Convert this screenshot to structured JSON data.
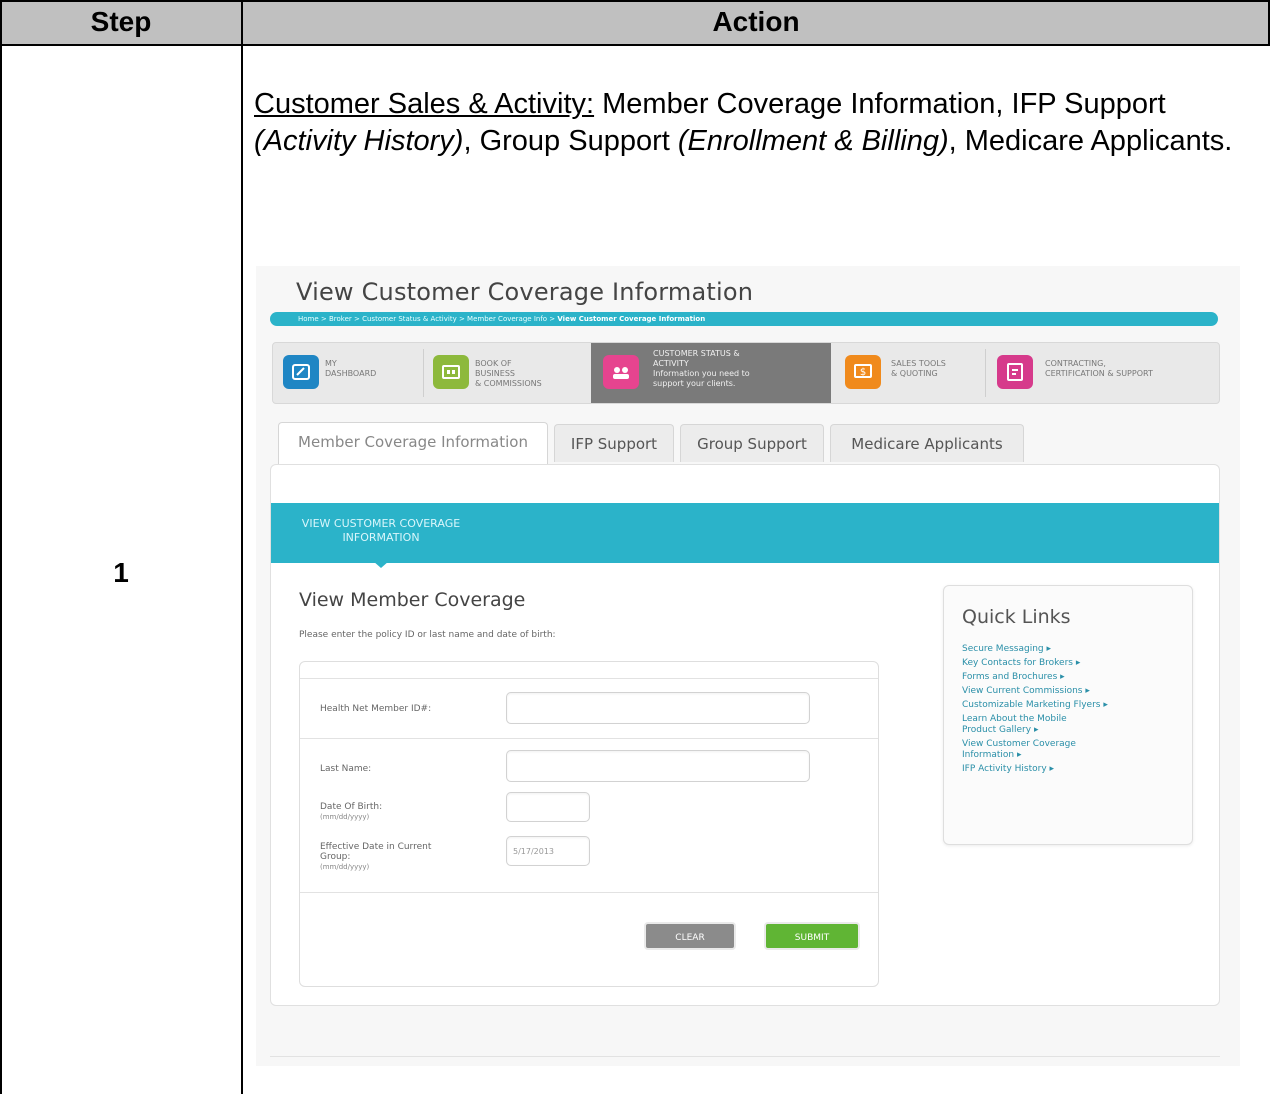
{
  "table": {
    "header_step": "Step",
    "header_action": "Action",
    "step_number": "1"
  },
  "instruction": {
    "lead": "Customer Sales & Activity:",
    "t1": " Member Coverage Information, IFP Support ",
    "i1": "(Activity History)",
    "t2": ", Group Support ",
    "i2": "(Enrollment & Billing)",
    "t3": ", Medicare Applicants."
  },
  "screenshot": {
    "page_title": "View Customer Coverage Information",
    "breadcrumb": {
      "path": "Home > Broker > Customer Status & Activity > Member Coverage Info > ",
      "current": "View Customer Coverage Information"
    },
    "nav": [
      {
        "l1": "MY",
        "l2": "DASHBOARD",
        "l3": "",
        "l4": "",
        "color": "#1f86c4"
      },
      {
        "l1": "BOOK OF",
        "l2": "BUSINESS",
        "l3": "& COMMISSIONS",
        "l4": "",
        "color": "#8db93c"
      },
      {
        "l1": "CUSTOMER STATUS &",
        "l2": "ACTIVITY",
        "l3": "Information you need to",
        "l4": "support your clients.",
        "color": "#e6448f"
      },
      {
        "l1": "SALES TOOLS",
        "l2": "& QUOTING",
        "l3": "",
        "l4": "",
        "color": "#f08a1c"
      },
      {
        "l1": "CONTRACTING,",
        "l2": "CERTIFICATION & SUPPORT",
        "l3": "",
        "l4": "",
        "color": "#d63a8b"
      }
    ],
    "tabs": [
      "Member Coverage Information",
      "IFP Support",
      "Group Support",
      "Medicare Applicants"
    ],
    "banner_label": "VIEW CUSTOMER COVERAGE INFORMATION",
    "section_title": "View Member Coverage",
    "section_instruction": "Please enter the policy ID or last name and date of birth:",
    "form": {
      "member_id_label": "Health Net Member ID#:",
      "last_name_label": "Last Name:",
      "dob_label": "Date Of Birth:",
      "dob_hint": "(mm/dd/yyyy)",
      "eff_label_1": "Effective Date in Current",
      "eff_label_2": "Group:",
      "eff_hint": "(mm/dd/yyyy)",
      "eff_value": "5/17/2013",
      "clear_label": "CLEAR",
      "submit_label": "SUBMIT"
    },
    "quick_links": {
      "title": "Quick Links",
      "items": [
        "Secure Messaging",
        "Key Contacts for Brokers",
        "Forms and Brochures",
        "View Current Commissions",
        "Customizable Marketing Flyers",
        "Learn About the Mobile Product Gallery",
        "View Customer Coverage Information",
        "IFP Activity History"
      ]
    }
  }
}
